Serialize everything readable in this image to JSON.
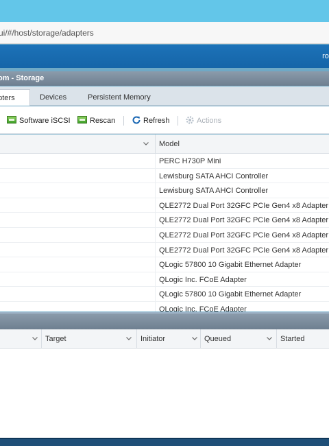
{
  "browser": {
    "url": "ui/#/host/storage/adapters"
  },
  "header": {
    "user": "roo"
  },
  "panel": {
    "title": "om - Storage"
  },
  "tabs": [
    {
      "label": "apters"
    },
    {
      "label": "Devices"
    },
    {
      "label": "Persistent Memory"
    }
  ],
  "toolbar": {
    "software_iscsi": "Software iSCSI",
    "rescan": "Rescan",
    "refresh": "Refresh",
    "actions": "Actions"
  },
  "adapters_table": {
    "columns": {
      "model": "Model"
    },
    "rows": [
      {
        "model": "PERC H730P Mini"
      },
      {
        "model": "Lewisburg SATA AHCI Controller"
      },
      {
        "model": "Lewisburg SATA AHCI Controller"
      },
      {
        "model": "QLE2772 Dual Port 32GFC PCIe Gen4 x8 Adapter"
      },
      {
        "model": "QLE2772 Dual Port 32GFC PCIe Gen4 x8 Adapter"
      },
      {
        "model": "QLE2772 Dual Port 32GFC PCIe Gen4 x8 Adapter"
      },
      {
        "model": "QLE2772 Dual Port 32GFC PCIe Gen4 x8 Adapter"
      },
      {
        "model": "QLogic 57800 10 Gigabit Ethernet Adapter"
      },
      {
        "model": "QLogic Inc. FCoE Adapter"
      },
      {
        "model": "QLogic 57800 10 Gigabit Ethernet Adapter"
      },
      {
        "model": "QLogic Inc. FCoE Adapter"
      }
    ]
  },
  "tasks_table": {
    "columns": {
      "target": "Target",
      "initiator": "Initiator",
      "queued": "Queued",
      "started": "Started"
    }
  }
}
